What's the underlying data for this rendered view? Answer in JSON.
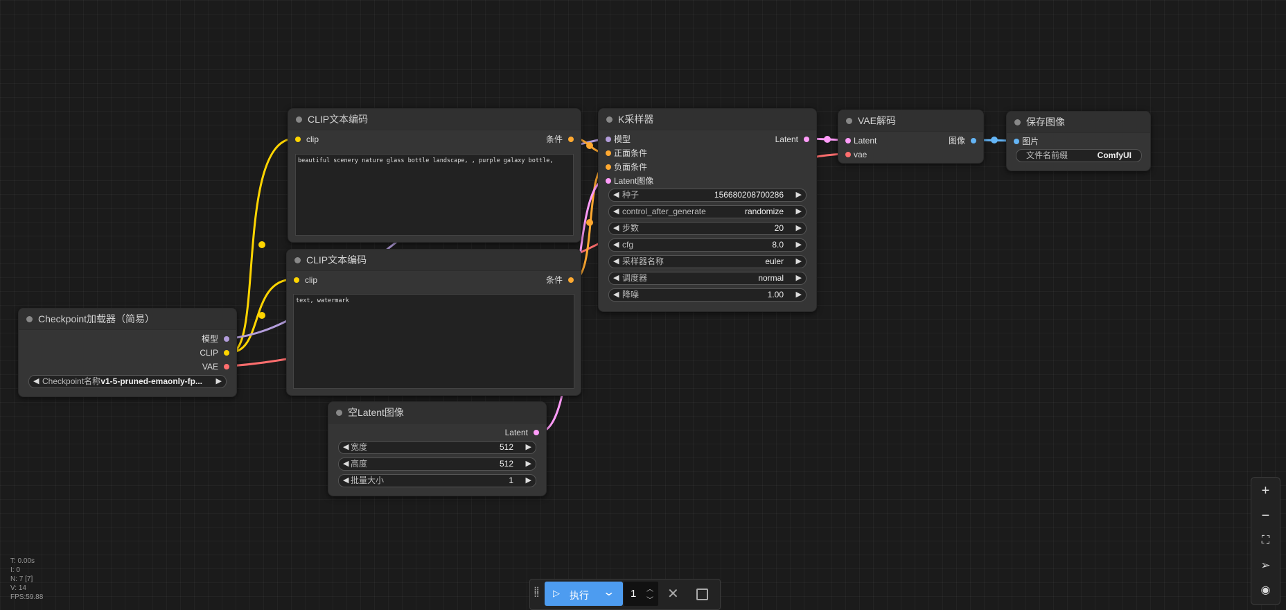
{
  "nodes": {
    "clip1": {
      "title": "CLIP文本编码",
      "input_clip": "clip",
      "output": "条件",
      "text": "beautiful scenery nature glass bottle landscape, , purple galaxy bottle,"
    },
    "clip2": {
      "title": "CLIP文本编码",
      "input_clip": "clip",
      "output": "条件",
      "text": "text, watermark"
    },
    "checkpoint": {
      "title": "Checkpoint加载器（简易）",
      "outputs": [
        "模型",
        "CLIP",
        "VAE"
      ],
      "widget_label": "Checkpoint名称",
      "widget_value": "v1-5-pruned-emaonly-fp..."
    },
    "latent": {
      "title": "空Latent图像",
      "output": "Latent",
      "widgets": [
        {
          "label": "宽度",
          "value": "512"
        },
        {
          "label": "高度",
          "value": "512"
        },
        {
          "label": "批量大小",
          "value": "1"
        }
      ]
    },
    "ksampler": {
      "title": "K采样器",
      "inputs": [
        "模型",
        "正面条件",
        "负面条件",
        "Latent图像"
      ],
      "output": "Latent",
      "widgets": [
        {
          "label": "种子",
          "value": "156680208700286"
        },
        {
          "label": "control_after_generate",
          "value": "randomize"
        },
        {
          "label": "步数",
          "value": "20"
        },
        {
          "label": "cfg",
          "value": "8.0"
        },
        {
          "label": "采样器名称",
          "value": "euler"
        },
        {
          "label": "调度器",
          "value": "normal"
        },
        {
          "label": "降噪",
          "value": "1.00"
        }
      ]
    },
    "vae": {
      "title": "VAE解码",
      "inputs": [
        "Latent",
        "vae"
      ],
      "output": "图像"
    },
    "save": {
      "title": "保存图像",
      "input": "图片",
      "widget_label": "文件名前缀",
      "widget_value": "ComfyUI"
    }
  },
  "stats": {
    "t": "T: 0.00s",
    "i": "I: 0",
    "n": "N: 7 [7]",
    "v": "V: 14",
    "fps": "FPS:59.88"
  },
  "toolbar": {
    "run_label": "执行",
    "batch_count": "1"
  },
  "colors": {
    "model": "#b39ddb",
    "clip": "#ffd500",
    "vae": "#ff6e6e",
    "conditioning": "#ffa931",
    "latent": "#ff9cf9",
    "image": "#64b5f6",
    "run_button": "#4d9cf0"
  },
  "icons": {
    "zoom": [
      "plus-icon",
      "minus-icon",
      "fit-view-icon",
      "navigate-icon",
      "eye-icon"
    ]
  }
}
